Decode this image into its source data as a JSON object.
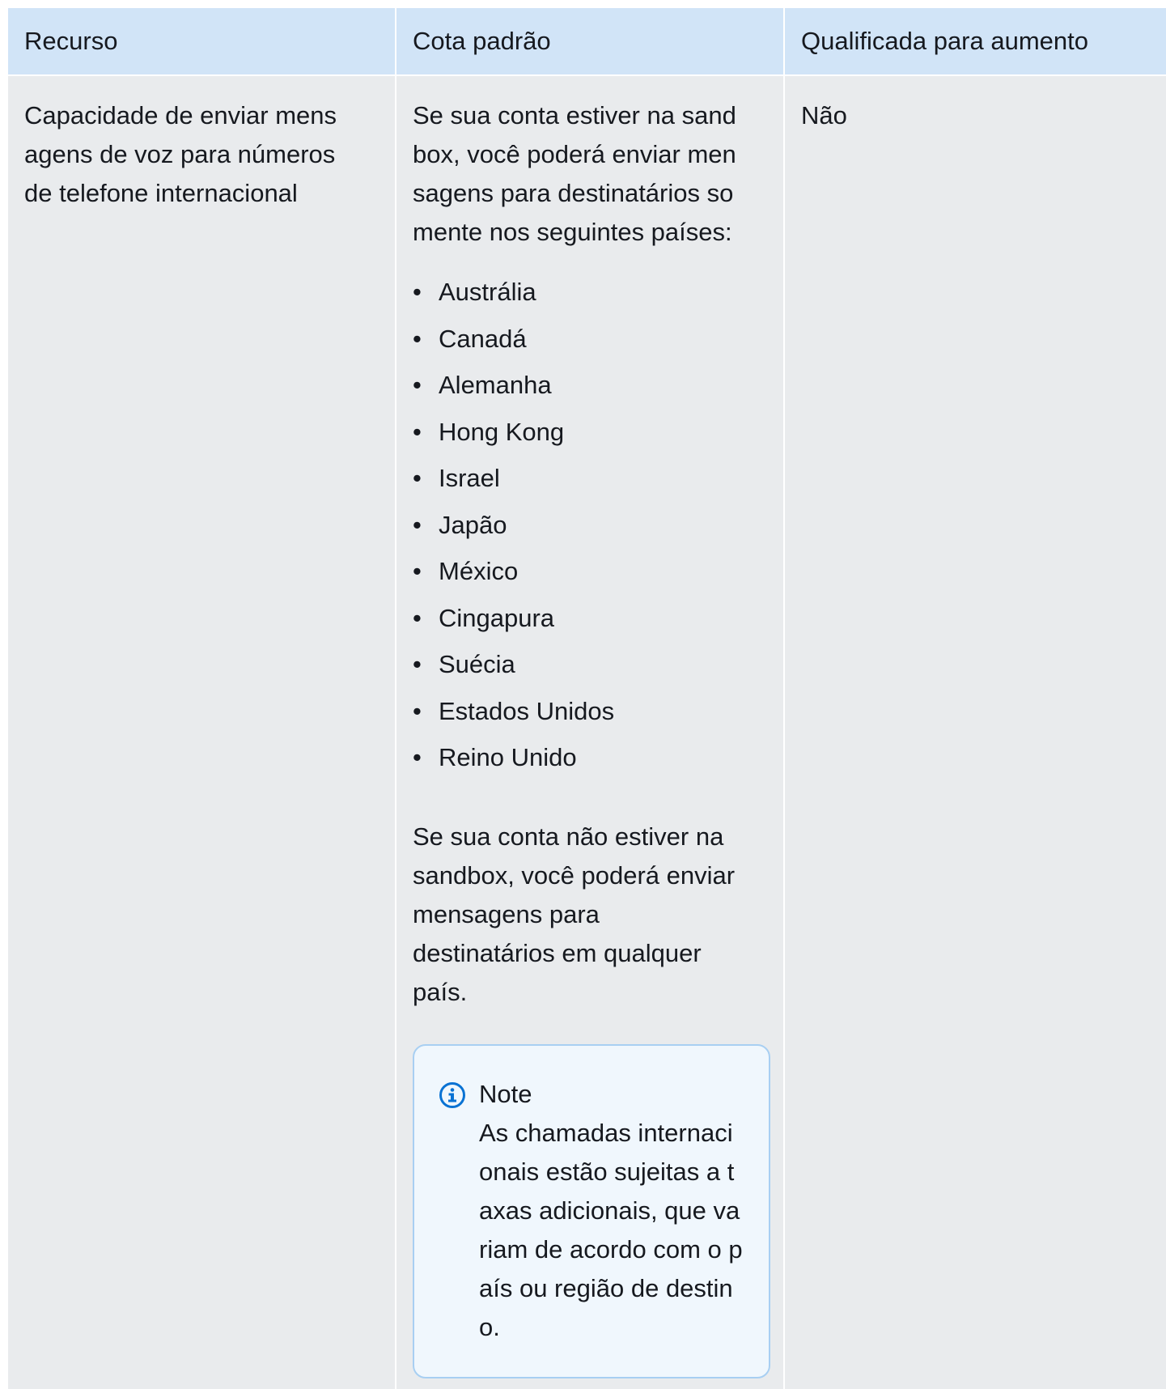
{
  "table": {
    "headers": {
      "col1": "Recurso",
      "col2": "Cota padrão",
      "col3": "Qualificada para aumento"
    },
    "row": {
      "resource": "Capacidade de enviar mensagens de voz para números de telefone internacional",
      "quota_intro": "Se sua conta estiver na sandbox, você poderá enviar mensagens para destinatários somente nos seguintes países:",
      "countries": [
        "Austrália",
        "Canadá",
        "Alemanha",
        "Hong Kong",
        "Israel",
        "Japão",
        "México",
        "Cingapura",
        "Suécia",
        "Estados Unidos",
        "Reino Unido"
      ],
      "quota_outro": "Se sua conta não estiver na sandbox, você poderá enviar mensagens para destinatários em qualquer país.",
      "note": {
        "title": "Note",
        "body": "As chamadas internacionais estão sujeitas a taxas adicionais, que variam de acordo com o país ou região de destino.",
        "icon": "info-icon",
        "icon_color": "#0972d3"
      },
      "eligible": "Não"
    }
  },
  "colors": {
    "header_bg": "#d1e4f7",
    "cell_bg": "#e9ebed",
    "note_bg": "#f0f7fd",
    "note_border": "#a8cff2",
    "text": "#16191f"
  }
}
